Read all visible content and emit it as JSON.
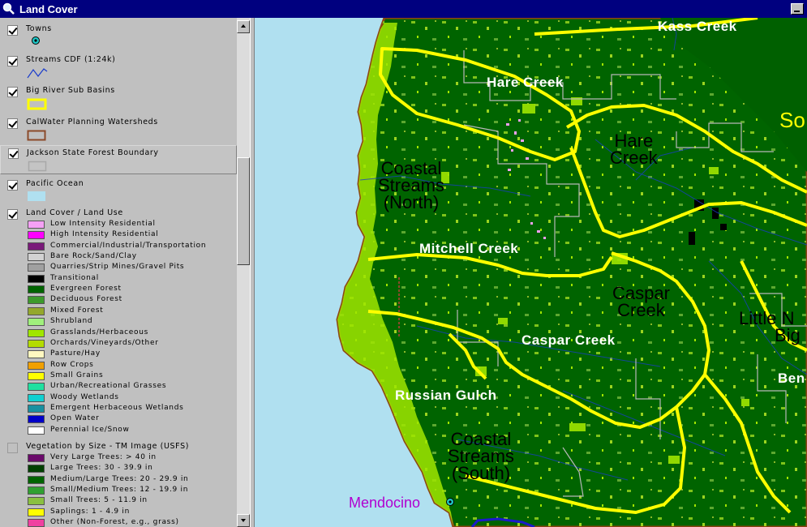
{
  "window": {
    "title": "Land Cover"
  },
  "toc": {
    "layers": [
      {
        "name": "Towns",
        "checked": true
      },
      {
        "name": "Streams CDF (1:24k)",
        "checked": true
      },
      {
        "name": "Big River Sub Basins",
        "checked": true
      },
      {
        "name": "CalWater Planning Watersheds",
        "checked": true
      },
      {
        "name": "Jackson State Forest Boundary",
        "checked": true
      },
      {
        "name": "Pacific Ocean",
        "checked": true
      },
      {
        "name": "Land Cover / Land Use",
        "checked": true
      },
      {
        "name": "Vegetation by Size - TM Image (USFS)",
        "checked": false
      }
    ],
    "land_cover_classes": [
      {
        "label": "Low Intensity Residential",
        "color": "#f5a0f5"
      },
      {
        "label": "High Intensity Residential",
        "color": "#ff00ff"
      },
      {
        "label": "Commercial/Industrial/Transportation",
        "color": "#7a1a7a"
      },
      {
        "label": "Bare Rock/Sand/Clay",
        "color": "#d2d2d2"
      },
      {
        "label": "Quarries/Strip Mines/Gravel Pits",
        "color": "#a0a0a0"
      },
      {
        "label": "Transitional",
        "color": "#000000"
      },
      {
        "label": "Evergreen Forest",
        "color": "#006400"
      },
      {
        "label": "Deciduous Forest",
        "color": "#3c9a2c"
      },
      {
        "label": "Mixed Forest",
        "color": "#94a82c"
      },
      {
        "label": "Shrubland",
        "color": "#a0f07c"
      },
      {
        "label": "Grasslands/Herbaceous",
        "color": "#a0e600"
      },
      {
        "label": "Orchards/Vineyards/Other",
        "color": "#b4dc00"
      },
      {
        "label": "Pasture/Hay",
        "color": "#fff8c0"
      },
      {
        "label": "Row Crops",
        "color": "#f0a000"
      },
      {
        "label": "Small Grains",
        "color": "#ffff00"
      },
      {
        "label": "Urban/Recreational Grasses",
        "color": "#20e0a0"
      },
      {
        "label": "Woody Wetlands",
        "color": "#10d0d0"
      },
      {
        "label": "Emergent Herbaceous Wetlands",
        "color": "#1890a0"
      },
      {
        "label": "Open Water",
        "color": "#0000c8"
      },
      {
        "label": "Perennial Ice/Snow",
        "color": "#ffffff"
      }
    ],
    "vegetation_classes": [
      {
        "label": "Very Large Trees: > 40  in",
        "color": "#6a0a6a"
      },
      {
        "label": "Large Trees: 30 - 39.9 in",
        "color": "#004000"
      },
      {
        "label": "Medium/Large Trees: 20 - 29.9 in",
        "color": "#006400"
      },
      {
        "label": "Small/Medium Trees: 12 - 19.9 in",
        "color": "#30a030"
      },
      {
        "label": "Small Trees: 5 - 11.9 in",
        "color": "#8ac040"
      },
      {
        "label": "Saplings: 1 - 4.9 in",
        "color": "#ffff00"
      },
      {
        "label": "Other (Non-Forest, e.g., grass)",
        "color": "#f040a0"
      }
    ]
  },
  "map": {
    "labels": {
      "kass_creek": "Kass Creek",
      "hare_creek_1": "Hare Creek",
      "hare_creek_2_line1": "Hare",
      "hare_creek_2_line2": "Creek",
      "coastal_north_line1": "Coastal",
      "coastal_north_line2": "Streams",
      "coastal_north_line3": "(North)",
      "mitchell_creek": "Mitchell Creek",
      "caspar_creek_1_line1": "Caspar",
      "caspar_creek_1_line2": "Creek",
      "caspar_creek_2": "Caspar Creek",
      "little_line1": "Little N",
      "little_line2": "Big",
      "ben": "Ben",
      "so": "So",
      "russian_gulch": "Russian Gulch",
      "coastal_south_line1": "Coastal",
      "coastal_south_line2": "Streams",
      "coastal_south_line3": "(South)",
      "mendocino": "Mendocino"
    },
    "colors": {
      "ocean": "#b0e0f0",
      "forest": "#006400",
      "watershed_boundary": "#ffff00",
      "coastline": "#8b4513",
      "grass": "#a0e600"
    }
  }
}
